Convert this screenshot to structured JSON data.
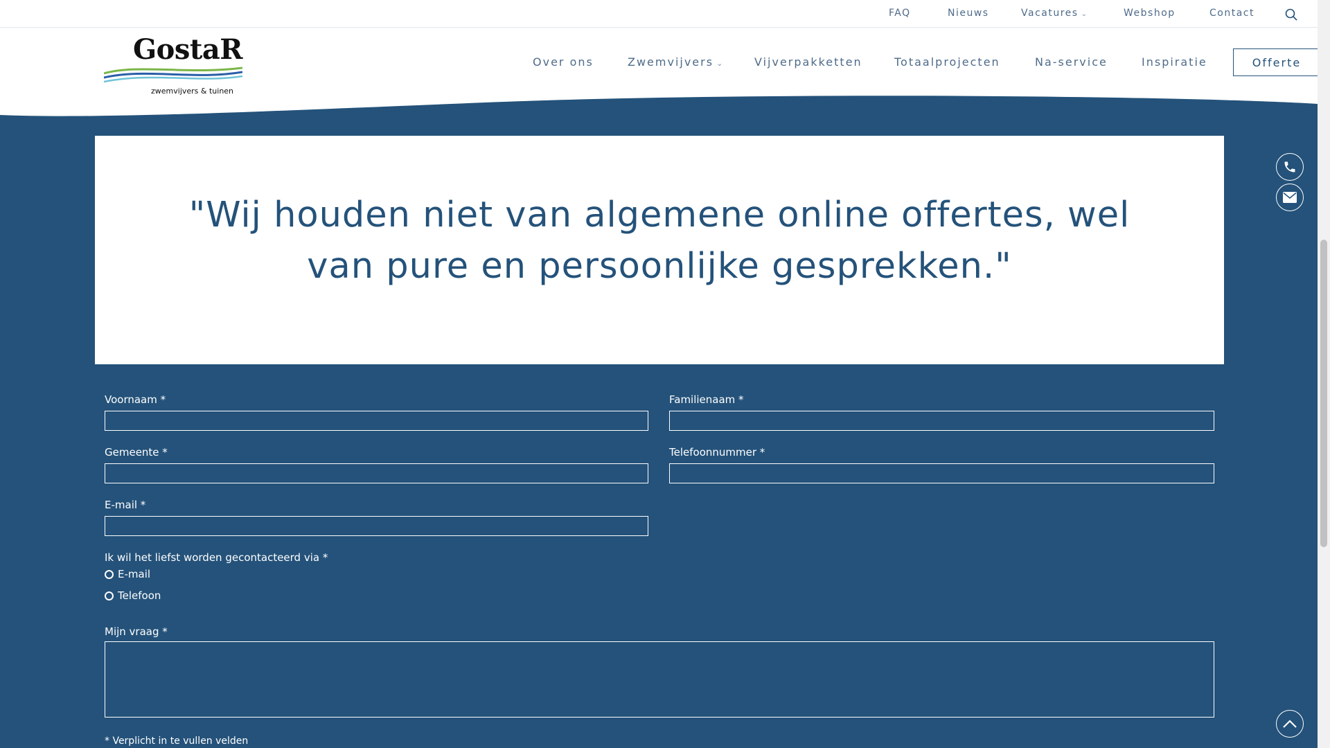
{
  "topbar": {
    "links": [
      {
        "label": "FAQ"
      },
      {
        "label": "Nieuws"
      },
      {
        "label": "Vacatures"
      },
      {
        "label": "Webshop"
      },
      {
        "label": "Contact"
      }
    ],
    "search_icon": "search-icon"
  },
  "logo": {
    "name": "GostaR",
    "tagline": "zwemvijvers & tuinen"
  },
  "nav": {
    "items": [
      {
        "label": "Over ons"
      },
      {
        "label": "Zwemvijvers"
      },
      {
        "label": "Vijverpakketten"
      },
      {
        "label": "Totaalprojecten"
      },
      {
        "label": "Na-service"
      },
      {
        "label": "Inspiratie"
      }
    ],
    "cta": "Offerte"
  },
  "quote": {
    "text": "\"Wij houden niet van algemene online offertes, wel van pure en persoonlijke gesprekken.\""
  },
  "form": {
    "first_name_label": "Voornaam *",
    "last_name_label": "Familienaam *",
    "city_label": "Gemeente *",
    "phone_label": "Telefoonnummer *",
    "email_label": "E-mail *",
    "contact_pref_label": "Ik wil het liefst worden gecontacteerd via *",
    "contact_options": [
      "E-mail",
      "Telefoon"
    ],
    "question_label": "Mijn vraag *",
    "required_note": "* Verplicht in te vullen velden"
  },
  "floating": {
    "phone_icon": "phone-icon",
    "mail_icon": "mail-icon",
    "scroll_top_icon": "chevron-up-icon"
  },
  "colors": {
    "brand_blue": "#24527a",
    "nav_text": "#4e6b89",
    "white": "#ffffff"
  }
}
